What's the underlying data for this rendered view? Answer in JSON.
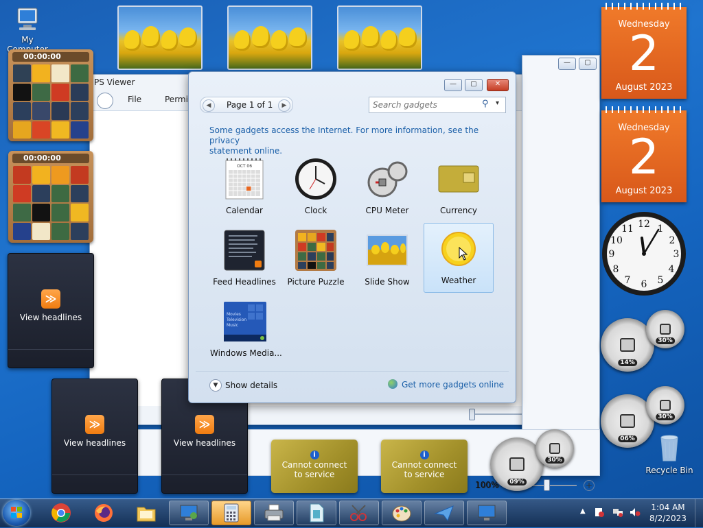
{
  "desktop": {
    "my_computer_label": "My Computer",
    "recycle_bin_label": "Recycle Bin"
  },
  "puzzles": [
    {
      "timer": "00:00:00"
    },
    {
      "timer": "00:00:00"
    }
  ],
  "feed_gadgets": [
    {
      "label": "View headlines"
    },
    {
      "label": "View headlines"
    },
    {
      "label": "View headlines"
    }
  ],
  "currency_gadgets": [
    {
      "line1": "Cannot connect",
      "line2": "to service"
    },
    {
      "line1": "Cannot connect",
      "line2": "to service"
    }
  ],
  "calendars": [
    {
      "weekday": "Wednesday",
      "day": "2",
      "month_year": "August 2023"
    },
    {
      "weekday": "Wednesday",
      "day": "2",
      "month_year": "August 2023"
    }
  ],
  "cpu_meters": [
    {
      "cpu": "14%",
      "memory": "30%"
    },
    {
      "cpu": "06%",
      "memory": "30%"
    },
    {
      "cpu": "09%",
      "memory": "30%"
    }
  ],
  "background_window": {
    "title_fragment": "PS Viewer",
    "menu": [
      "File",
      "Permis"
    ],
    "zoom": "100%"
  },
  "gallery": {
    "page_label": "Page 1 of 1",
    "search_placeholder": "Search gadgets",
    "notice_line1": "Some gadgets access the Internet.  For more information, see the privacy",
    "notice_line2": "statement online.",
    "items": [
      {
        "name": "Calendar"
      },
      {
        "name": "Clock"
      },
      {
        "name": "CPU Meter"
      },
      {
        "name": "Currency"
      },
      {
        "name": "Feed Headlines"
      },
      {
        "name": "Picture Puzzle"
      },
      {
        "name": "Slide Show"
      },
      {
        "name": "Weather"
      },
      {
        "name": "Windows Media..."
      }
    ],
    "selected_item": "Weather",
    "calendar_month": "OCT 06",
    "media_lines": [
      "Movies",
      "Television",
      "Music"
    ],
    "show_details_label": "Show details",
    "get_more_label": "Get more gadgets online"
  },
  "taskbar": {
    "time": "1:04 AM",
    "date": "8/2/2023"
  },
  "colors": {
    "calendar_orange": "#e8661f",
    "link_blue": "#1a5fa8",
    "taskbar": "#22426a"
  }
}
